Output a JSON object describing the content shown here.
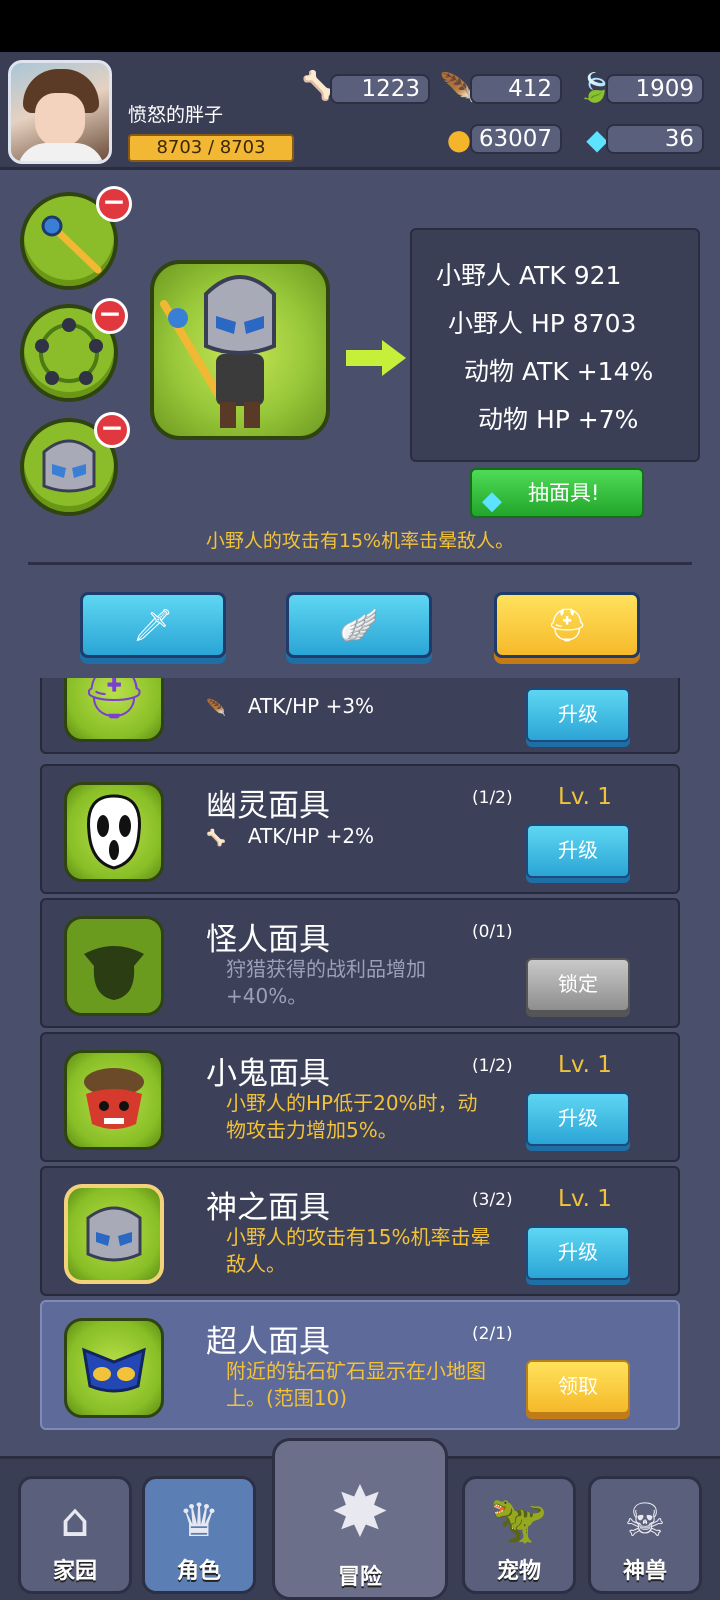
{
  "player": {
    "name": "愤怒的胖子",
    "hp": "8703 / 8703"
  },
  "resources": {
    "bone": "1223",
    "feather_orange": "412",
    "feather_green": "1909",
    "coin": "63007",
    "diamond": "36"
  },
  "equipment": {
    "slots": [
      "staff-icon",
      "ring-icon",
      "helmet-icon"
    ]
  },
  "stats": {
    "lines": [
      "小野人 ATK 921",
      "小野人 HP 8703",
      "动物 ATK +14%",
      "动物 HP +7%"
    ]
  },
  "gacha_button": "抽面具!",
  "skill_desc": "小野人的攻击有15%机率击晕敌人。",
  "tabs": [
    "sword-icon",
    "wing-icon",
    "helmet-icon"
  ],
  "items": [
    {
      "title": "",
      "count": "",
      "level": "",
      "bonus": "ATK/HP +3%",
      "button": "升级"
    },
    {
      "title": "幽灵面具",
      "count": "(1/2)",
      "level": "Lv. 1",
      "bonus": "ATK/HP +2%",
      "button": "升级"
    },
    {
      "title": "怪人面具",
      "count": "(0/1)",
      "desc": "狩猎获得的战利品增加+40%。",
      "button": "锁定"
    },
    {
      "title": "小鬼面具",
      "count": "(1/2)",
      "level": "Lv. 1",
      "desc": "小野人的HP低于20%时，动物攻击力增加5%。",
      "button": "升级"
    },
    {
      "title": "神之面具",
      "count": "(3/2)",
      "level": "Lv. 1",
      "desc": "小野人的攻击有15%机率击晕敌人。",
      "button": "升级"
    },
    {
      "title": "超人面具",
      "count": "(2/1)",
      "desc": "附近的钻石矿石显示在小地图上。(范围10)",
      "button": "领取"
    }
  ],
  "nav": [
    "家园",
    "角色",
    "冒险",
    "宠物",
    "神兽"
  ]
}
